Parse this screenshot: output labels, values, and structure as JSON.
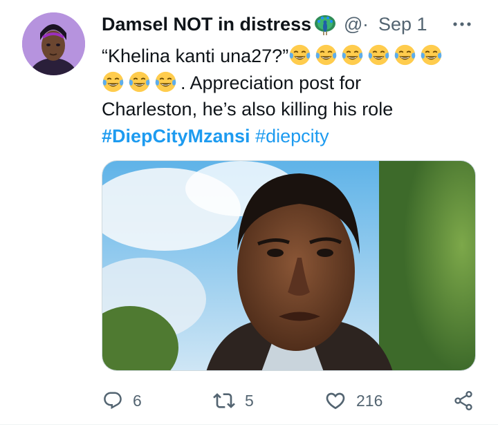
{
  "tweet": {
    "display_name": "Damsel NOT in distress",
    "name_emoji": "peacock-emoji",
    "handle": "@",
    "separator": "·",
    "date": "Sep 1",
    "more_icon": "more-horizontal-icon",
    "text_line1": "“Khelina kanti una27?”",
    "text_line2": ". Appreciation post for",
    "text_line3": "Charleston, he’s also killing his role",
    "hashtag1": "#DiepCityMzansi",
    "hashtag2": "#diepcity",
    "emoji": "face-with-tears-of-joy",
    "emoji_count_line1": 6,
    "emoji_count_line2": 3,
    "media_alt": "photo"
  },
  "actions": {
    "reply_icon": "reply-icon",
    "reply_count": "6",
    "retweet_icon": "retweet-icon",
    "retweet_count": "5",
    "like_icon": "heart-icon",
    "like_count": "216",
    "share_icon": "share-icon"
  },
  "colors": {
    "text": "#0f1419",
    "secondary": "#536471",
    "link": "#1d9bf0",
    "border": "#cfd9de"
  }
}
